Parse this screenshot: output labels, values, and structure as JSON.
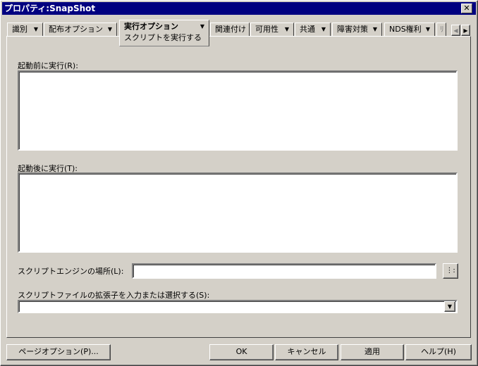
{
  "window": {
    "title": "プロパティ:SnapShot",
    "close": "✕"
  },
  "tabs": [
    {
      "label": "識別"
    },
    {
      "label": "配布オプション"
    },
    {
      "label": "実行オプション",
      "sub": "スクリプトを実行する"
    },
    {
      "label": "関連付け"
    },
    {
      "label": "可用性"
    },
    {
      "label": "共通"
    },
    {
      "label": "障害対策"
    },
    {
      "label": "NDS権利"
    },
    {
      "label": "ﾘ"
    }
  ],
  "form": {
    "pre_run_label": "起動前に実行(R):",
    "post_run_label": "起動後に実行(T):",
    "engine_label": "スクリプトエンジンの場所(L):",
    "engine_value": "",
    "ext_label": "スクリプトファイルの拡張子を入力または選択する(S):",
    "ext_value": ""
  },
  "buttons": {
    "page_options": "ページオプション(P)...",
    "ok": "OK",
    "cancel": "キャンセル",
    "apply": "適用",
    "help": "ヘルプ(H)"
  }
}
